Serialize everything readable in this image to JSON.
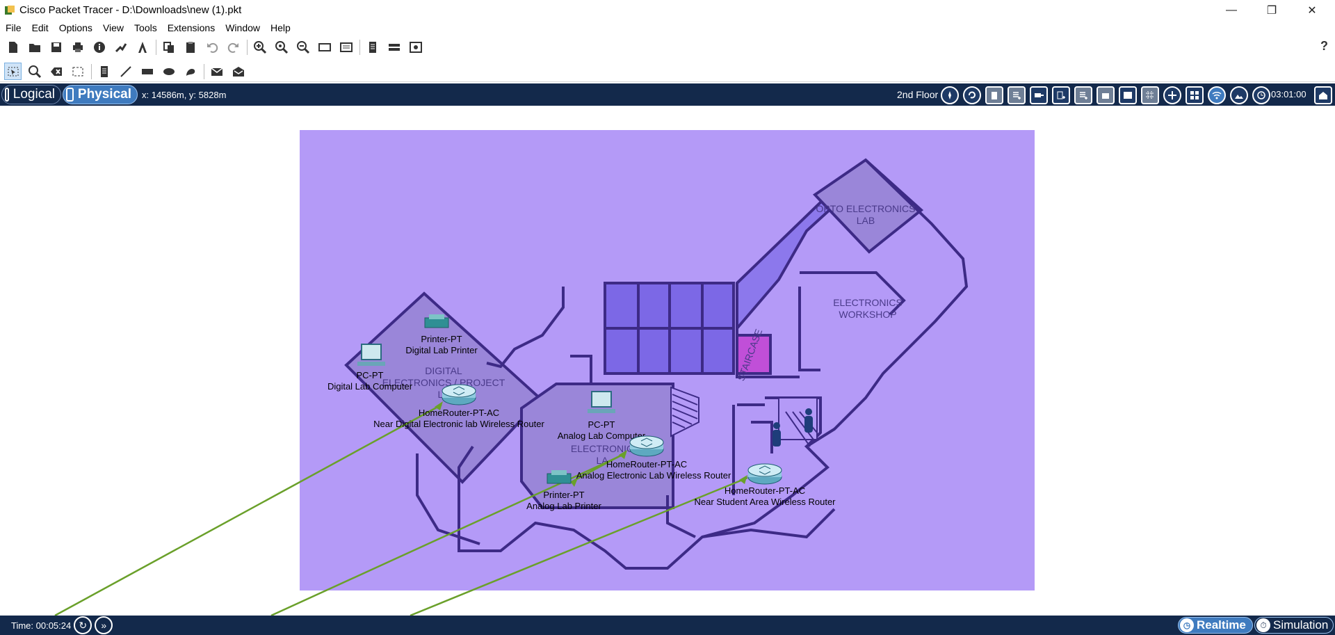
{
  "window": {
    "title": "Cisco Packet Tracer - D:\\Downloads\\new (1).pkt",
    "controls": {
      "minimize": "—",
      "maximize": "❐",
      "close": "✕"
    }
  },
  "menu": [
    "File",
    "Edit",
    "Options",
    "View",
    "Tools",
    "Extensions",
    "Window",
    "Help"
  ],
  "toolbar1": {
    "icons": [
      "new-file-icon",
      "open-folder-icon",
      "save-icon",
      "print-icon",
      "info-icon",
      "network-wizard-icon",
      "antenna-icon",
      "copy-icon",
      "paste-icon",
      "undo-icon",
      "redo-icon",
      "zoom-in-icon",
      "zoom-reset-icon",
      "zoom-out-icon",
      "window-icon",
      "palette-icon",
      "view-list-icon",
      "device-icon",
      "custom-device-icon"
    ],
    "help": "?"
  },
  "toolbar2": {
    "icons": [
      "select-icon",
      "inspect-icon",
      "delete-icon",
      "resize-icon",
      "note-icon",
      "draw-line-icon",
      "rectangle-icon",
      "ellipse-icon",
      "freeform-icon",
      "add-pdu-icon",
      "add-complex-pdu-icon"
    ]
  },
  "navbar": {
    "logical_label": "Logical",
    "physical_label": "Physical",
    "coords": "x: 14586m, y: 5828m",
    "floor": "2nd Floor",
    "clock": "03:01:00",
    "icons": [
      "navigation-icon",
      "back-icon",
      "building-icon",
      "new-rack-icon",
      "move-icon",
      "add-floor-icon",
      "add-building-icon",
      "add-closet-icon",
      "background-icon",
      "grid-icon",
      "viewport-icon",
      "tile-icon",
      "wireless-icon",
      "environment-icon",
      "clock-icon",
      "home-icon"
    ]
  },
  "floorplan": {
    "rooms": {
      "opto": [
        "OPTO ELECTRONICS",
        "LAB"
      ],
      "workshop": [
        "ELECTRONICS",
        "WORKSHOP"
      ],
      "digital": [
        "DIGITAL",
        "ELECTRONICS / PROJECT",
        "LA"
      ],
      "analog": [
        "ELECTRONIC",
        "LA"
      ],
      "small": "STAIRCASE"
    },
    "devices": [
      {
        "type": "Printer-PT",
        "name": "Digital Lab Printer"
      },
      {
        "type": "PC-PT",
        "name": "Digital Lab Computer"
      },
      {
        "type": "HomeRouter-PT-AC",
        "name": "Near Digital Electronic lab Wireless Router"
      },
      {
        "type": "PC-PT",
        "name": "Analog Lab Computer"
      },
      {
        "type": "HomeRouter-PT-AC",
        "name": "Analog Electronic Lab Wireless Router"
      },
      {
        "type": "Printer-PT",
        "name": "Analog Lab Printer"
      },
      {
        "type": "HomeRouter-PT-AC",
        "name": "Near Student Area Wireless Router"
      }
    ]
  },
  "statusbar": {
    "time": "Time: 00:05:24",
    "realtime": "Realtime",
    "simulation": "Simulation"
  },
  "colors": {
    "navbar_bg": "#13294b",
    "active_tab": "#3f7bbf",
    "floor_bg": "#b49af7",
    "wall": "#3d2a86",
    "link": "#6aa02a"
  }
}
